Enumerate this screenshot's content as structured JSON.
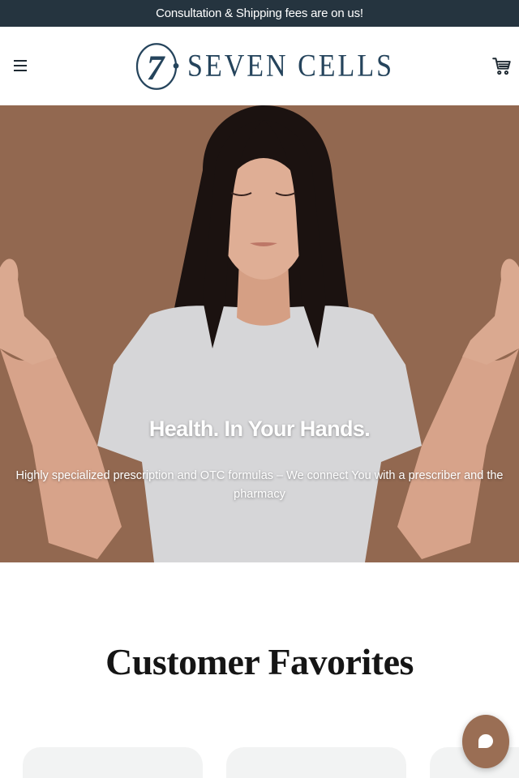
{
  "announcement": {
    "text": "Consultation & Shipping fees are on us!"
  },
  "header": {
    "brand_name": "SEVEN CELLS",
    "logo_mark": "7",
    "menu_icon": "hamburger-menu-icon",
    "cart_icon": "shopping-cart-icon"
  },
  "hero": {
    "title": "Health. In Your Hands.",
    "subtitle": "Highly specialized prescription and OTC formulas – We connect You with a prescriber and the pharmacy"
  },
  "favorites": {
    "title": "Customer Favorites"
  },
  "chat": {
    "icon": "chat-bubble-icon"
  },
  "colors": {
    "announcement_bg": "#25343f",
    "brand_navy": "#25445c",
    "hero_bg": "#9a6e54",
    "card_bg": "#f2f3f3"
  }
}
